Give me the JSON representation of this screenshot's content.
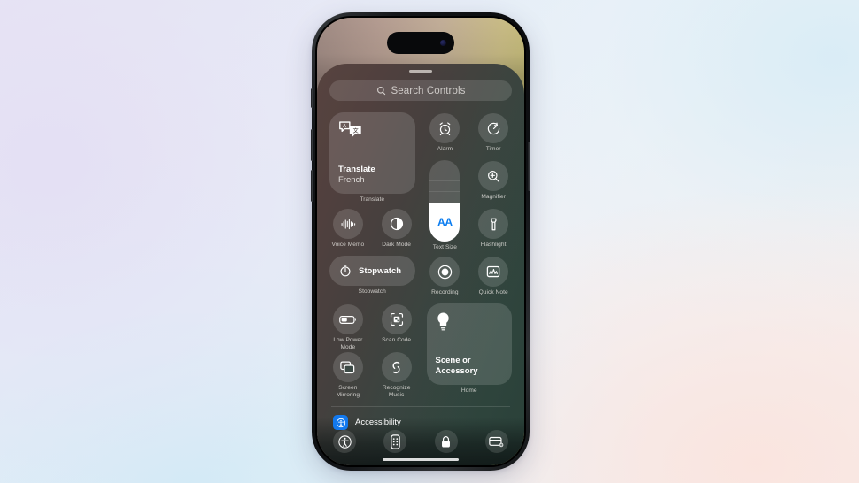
{
  "device": {
    "name": "iphone-16-pro",
    "frame_color": "#15171a",
    "wallpaper_colors": [
      "#a08b84",
      "#c2ae98",
      "#c3bd71"
    ],
    "island_label": "dynamic-island"
  },
  "control_center": {
    "panel_gradient": [
      "#56423e",
      "#42403c",
      "#26423c"
    ],
    "grabber": "drag-handle",
    "search": {
      "icon": "search-icon",
      "placeholder": "Search Controls",
      "value": ""
    },
    "translate_tile": {
      "title": "Translate",
      "subtitle": "French",
      "caption": "Translate",
      "icon": "translate-bubbles-icon"
    },
    "controls": [
      {
        "id": "alarm",
        "label": "Alarm",
        "icon": "alarm-clock-icon"
      },
      {
        "id": "timer",
        "label": "Timer",
        "icon": "timer-icon"
      },
      {
        "id": "magnifier",
        "label": "Magnifier",
        "icon": "magnifier-icon"
      },
      {
        "id": "voice-memo",
        "label": "Voice Memo",
        "icon": "waveform-icon"
      },
      {
        "id": "dark-mode",
        "label": "Dark Mode",
        "icon": "dark-mode-circle-icon"
      },
      {
        "id": "flashlight",
        "label": "Flashlight",
        "icon": "flashlight-icon"
      },
      {
        "id": "recording",
        "label": "Recording",
        "icon": "screen-record-icon"
      },
      {
        "id": "quick-note",
        "label": "Quick Note",
        "icon": "quick-note-icon"
      },
      {
        "id": "low-power-mode",
        "label": "Low Power\nMode",
        "icon": "battery-low-icon"
      },
      {
        "id": "scan-code",
        "label": "Scan Code",
        "icon": "qr-scan-icon"
      },
      {
        "id": "screen-mirroring",
        "label": "Screen\nMirroring",
        "icon": "screen-mirroring-icon"
      },
      {
        "id": "recognize-music",
        "label": "Recognize\nMusic",
        "icon": "shazam-icon"
      }
    ],
    "text_size": {
      "label": "Text Size",
      "glyph": "AA",
      "glyph_color": "#0a7cf0",
      "fill_percent": 48
    },
    "stopwatch_tile": {
      "label": "Stopwatch",
      "caption": "Stopwatch",
      "icon": "stopwatch-icon"
    },
    "scene_tile": {
      "title": "Scene or\nAccessory",
      "caption": "Home",
      "icon": "lightbulb-icon"
    },
    "accessibility_row": {
      "label": "Accessibility",
      "badge_icon": "accessibility-badge-icon",
      "badge_color": "#1278ed"
    },
    "dock": [
      {
        "id": "accessibility-shortcut",
        "icon": "accessibility-person-icon"
      },
      {
        "id": "apple-tv-remote",
        "icon": "tv-remote-icon"
      },
      {
        "id": "screen-lock",
        "icon": "lock-icon"
      },
      {
        "id": "wallet",
        "icon": "wallet-card-icon"
      }
    ]
  }
}
